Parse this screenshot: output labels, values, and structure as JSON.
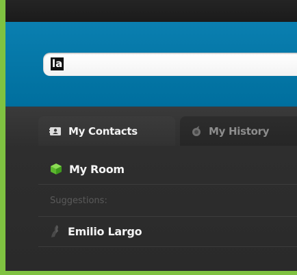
{
  "search": {
    "value": "la"
  },
  "tabs": [
    {
      "label": "My Contacts",
      "icon": "contacts-card-icon",
      "active": true
    },
    {
      "label": "My History",
      "icon": "history-icon",
      "active": false
    }
  ],
  "rooms": [
    {
      "label": "My Room",
      "icon": "room-cube-icon"
    }
  ],
  "suggestions": {
    "header": "Suggestions:",
    "items": [
      {
        "label": "Emilio Largo",
        "icon": "person-silhouette-icon"
      }
    ]
  },
  "colors": {
    "accent_blue": "#0a7fb0",
    "frame_green": "#7fc241",
    "panel_dark": "#2c2c2c",
    "room_green": "#5cb82e"
  }
}
